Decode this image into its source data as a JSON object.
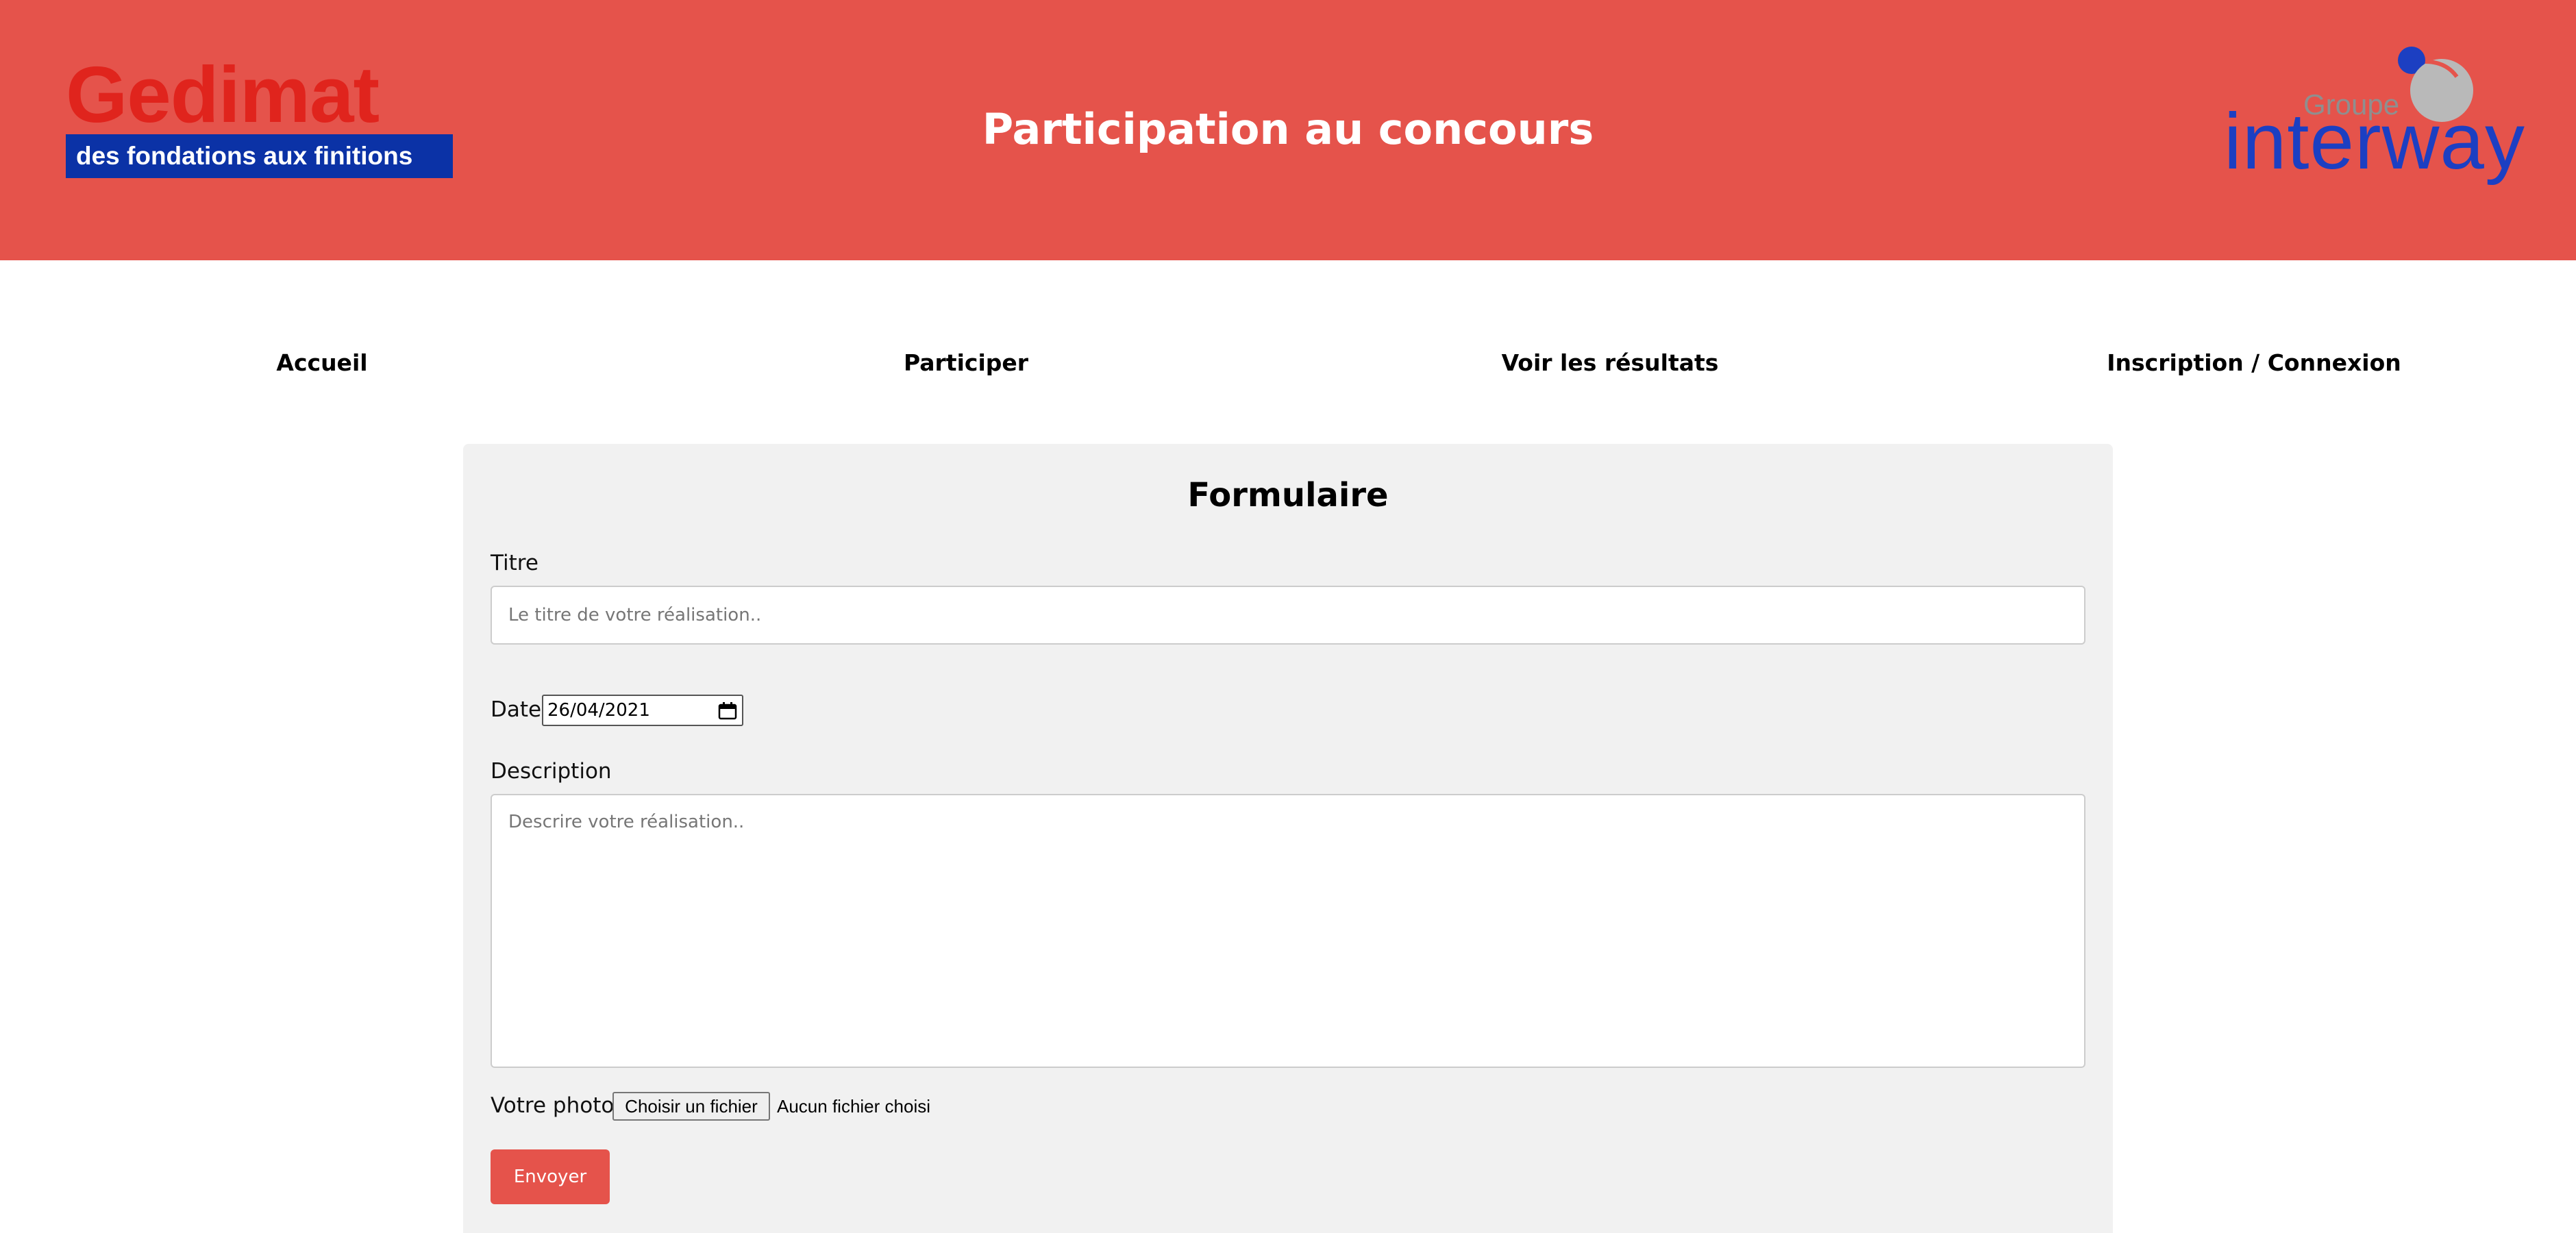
{
  "header": {
    "brand": {
      "name": "Gedimat",
      "tagline": "des fondations aux finitions"
    },
    "title": "Participation au concours",
    "partner": {
      "group_label": "Groupe",
      "name": "interway"
    },
    "background_color": "#e5534b"
  },
  "nav": {
    "items": [
      {
        "label": "Accueil"
      },
      {
        "label": "Participer"
      },
      {
        "label": "Voir les résultats"
      },
      {
        "label": "Inscription / Connexion"
      }
    ]
  },
  "form": {
    "title": "Formulaire",
    "titre": {
      "label": "Titre",
      "value": "",
      "placeholder": "Le titre de votre réalisation.."
    },
    "date": {
      "label": "Date",
      "value": "26/04/2021",
      "icon": "calendar-icon"
    },
    "description": {
      "label": "Description",
      "value": "",
      "placeholder": "Descrire votre réalisation.."
    },
    "photo": {
      "label": "Votre photo",
      "button_label": "Choisir un fichier",
      "status": "Aucun fichier choisi"
    },
    "submit_label": "Envoyer",
    "card_color": "#f1f1f1",
    "accent_color": "#e5534b"
  }
}
